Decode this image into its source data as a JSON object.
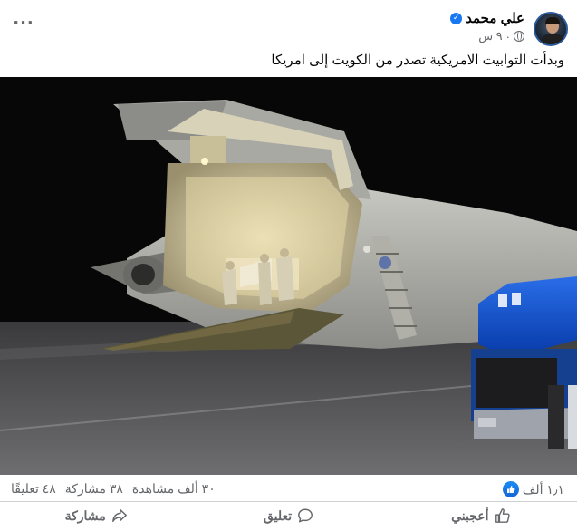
{
  "post": {
    "author": "علي محمد",
    "time": "٩ س",
    "separator": "·",
    "caption": "وبدأت التوابيت الامريكية تصدر من الكويت إلى امريكا"
  },
  "stats": {
    "reactions_count": "١٫١ ألف",
    "comments": "٤٨ تعليقًا",
    "shares": "٣٨ مشاركة",
    "views": "٣٠ ألف مشاهدة"
  },
  "actions": {
    "like": "أعجبني",
    "comment": "تعليق",
    "share": "مشاركة"
  },
  "icons": {
    "more": "more-options-icon",
    "verified": "verified-badge-icon",
    "audience": "globe-icon",
    "like": "thumbs-up-icon",
    "comment": "speech-bubble-icon",
    "share": "share-arrow-icon"
  },
  "colors": {
    "brand_blue": "#1877f2",
    "secondary_text": "#65676b",
    "divider": "#ced0d4"
  }
}
